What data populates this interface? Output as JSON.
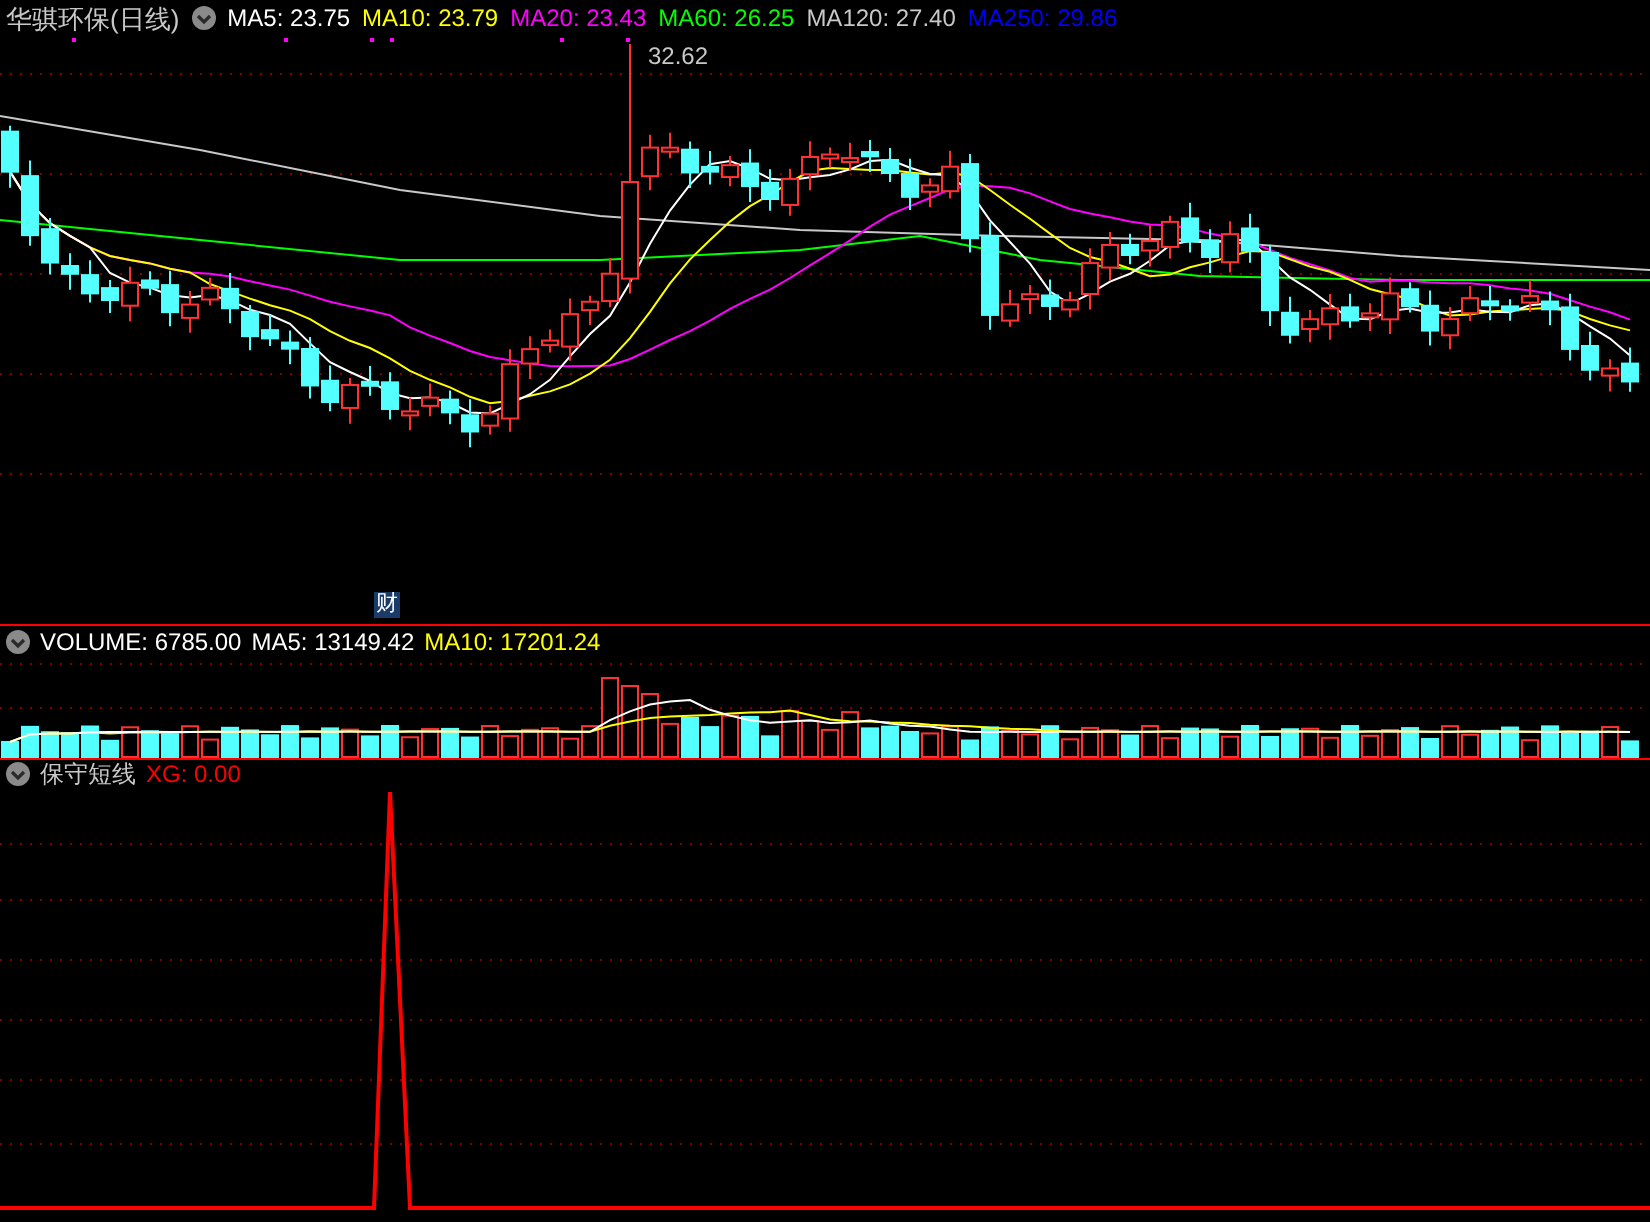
{
  "main_panel": {
    "title": "华骐环保(日线)",
    "indicators": [
      {
        "label": "MA5: 23.75",
        "color": "#ffffff"
      },
      {
        "label": "MA10: 23.79",
        "color": "#ffff00"
      },
      {
        "label": "MA20: 23.43",
        "color": "#ff00ff"
      },
      {
        "label": "MA60: 26.25",
        "color": "#00ff00"
      },
      {
        "label": "MA120: 27.40",
        "color": "#c8c8c8"
      },
      {
        "label": "MA250: 29.86",
        "color": "#0000ff"
      }
    ],
    "high_marker": "32.62",
    "finance_badge": "财"
  },
  "volume_panel": {
    "indicators": [
      {
        "label": "VOLUME: 6785.00",
        "color": "#ffffff"
      },
      {
        "label": "MA5: 13149.42",
        "color": "#ffffff"
      },
      {
        "label": "MA10: 17201.24",
        "color": "#ffff00"
      }
    ]
  },
  "signal_panel": {
    "title": "保守短线",
    "indicators": [
      {
        "label": "XG: 0.00",
        "color": "#ff0000"
      }
    ]
  }
}
